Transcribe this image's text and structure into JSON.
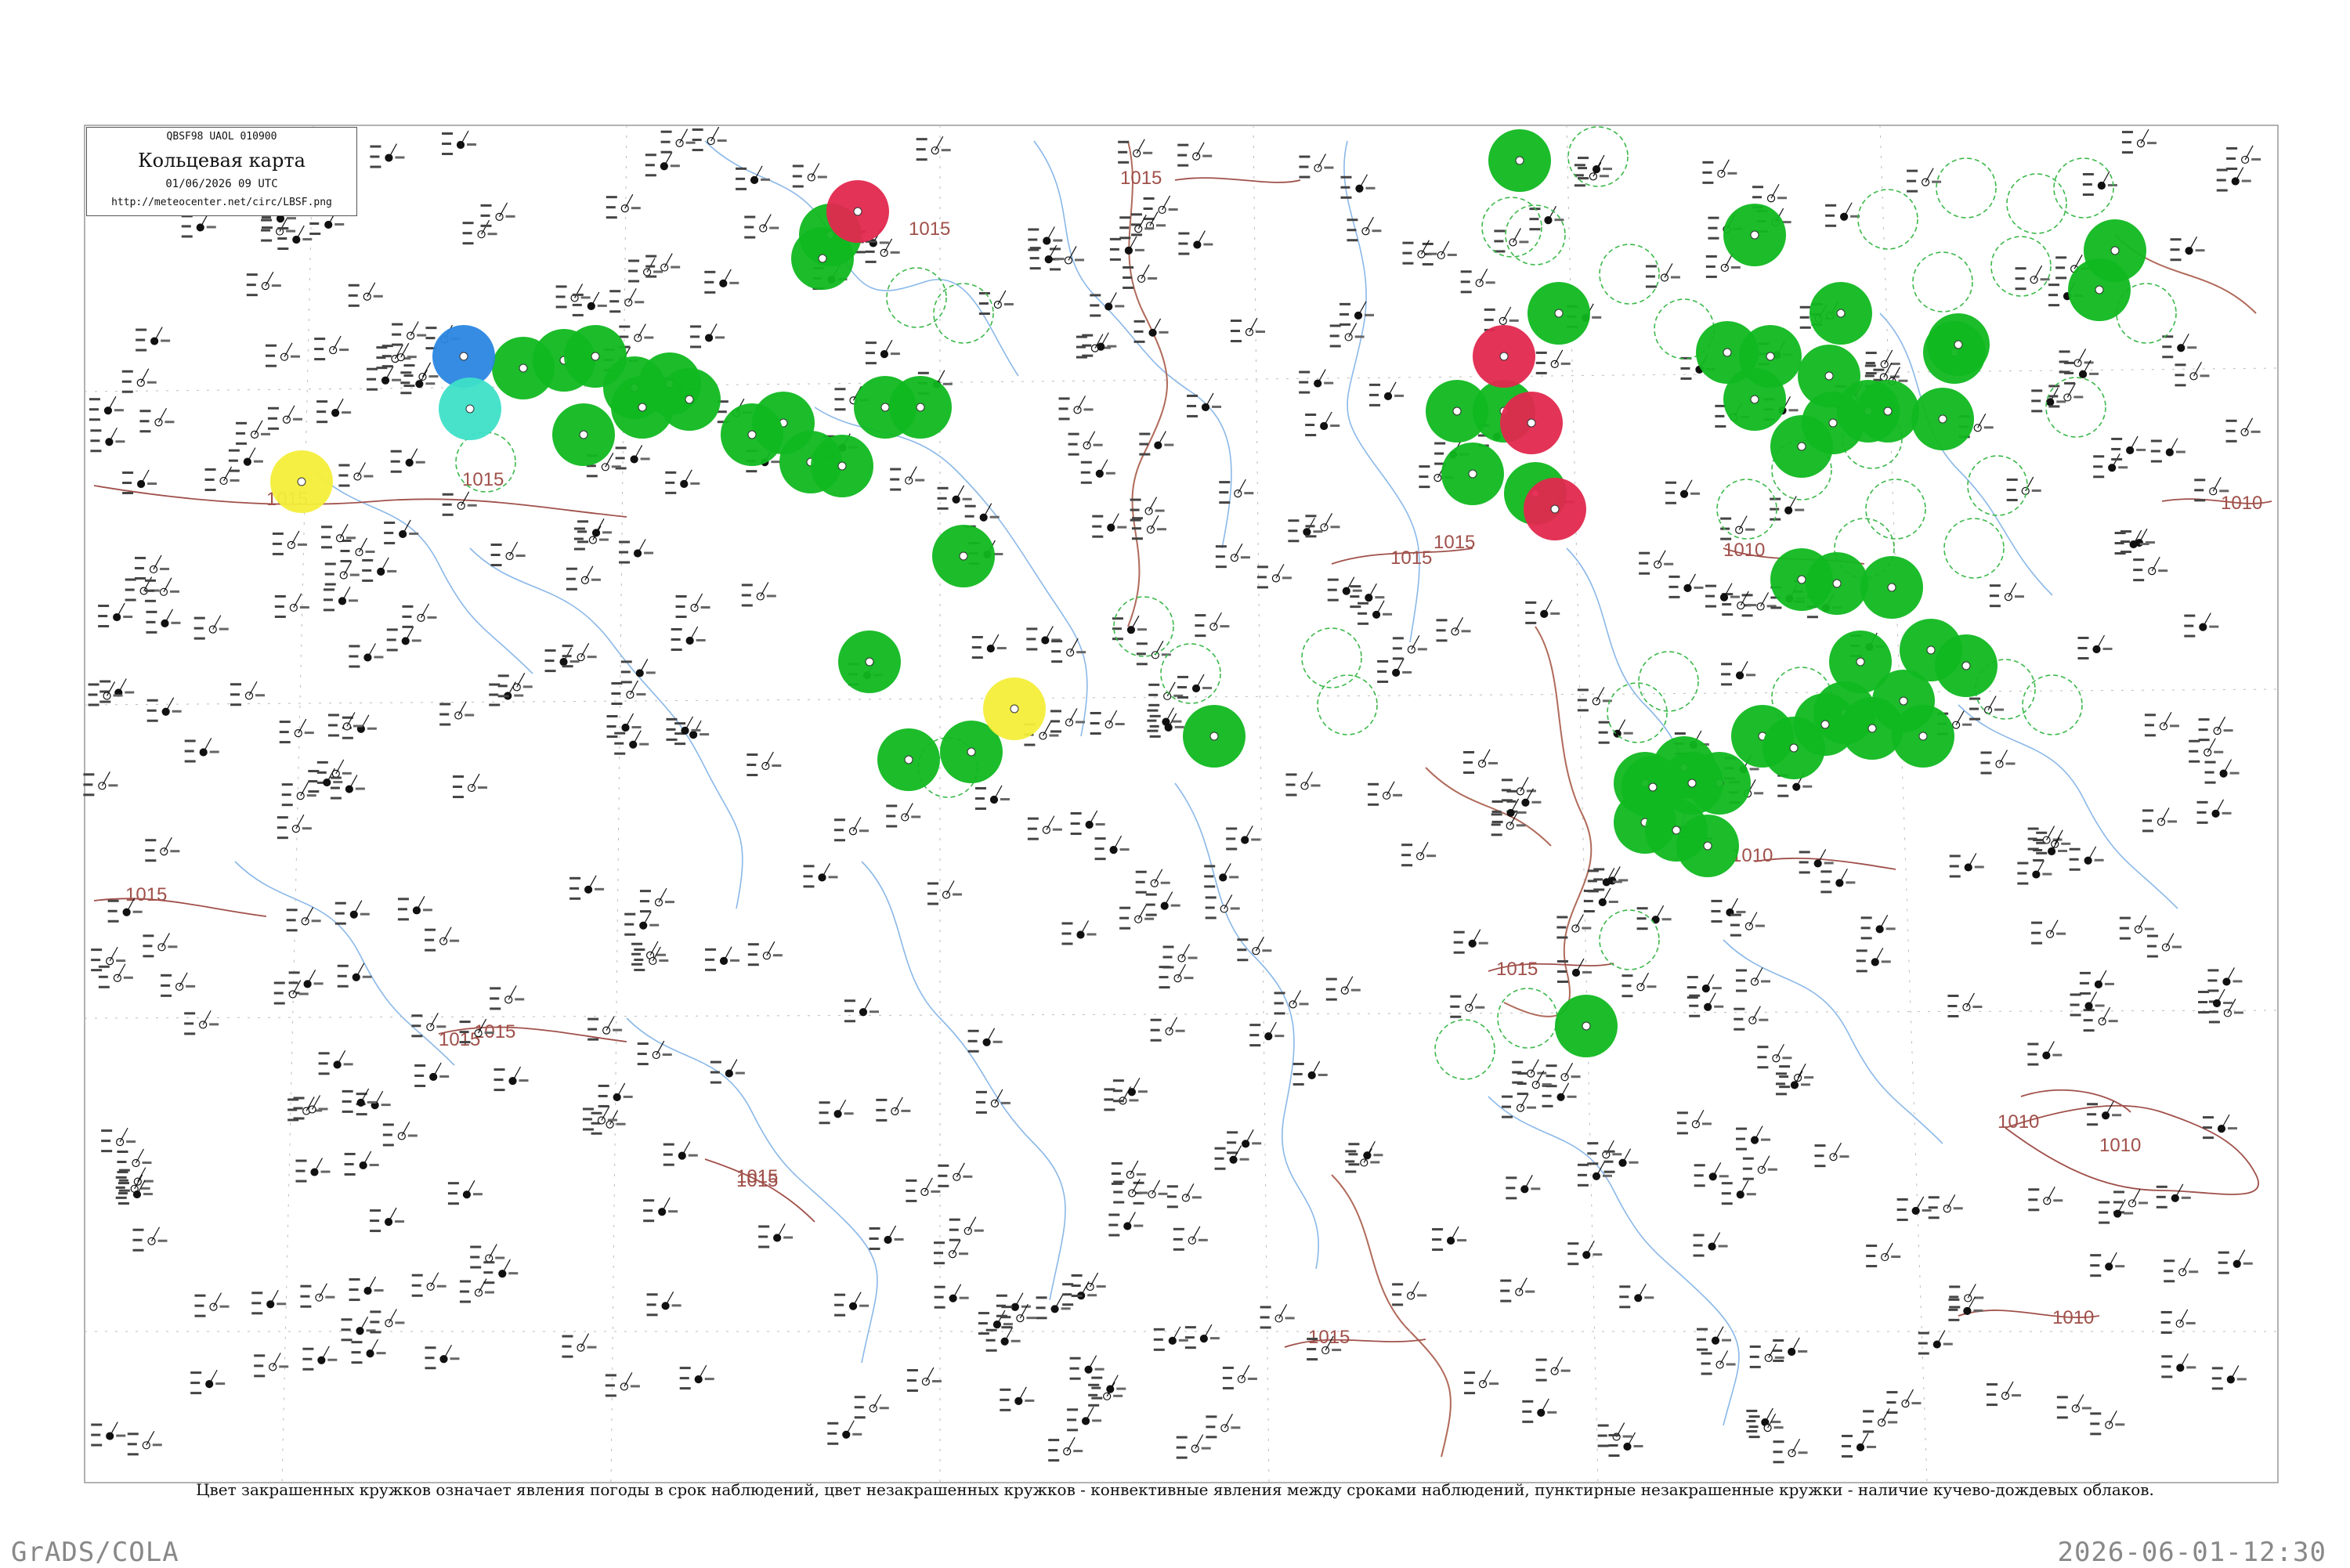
{
  "header": {
    "line1": "QBSF98  UAOL  010900",
    "title": "Кольцевая карта",
    "datetime": "01/06/2026 09 UTC",
    "url": "http://meteocenter.net/circ/LBSF.png"
  },
  "caption": "Цвет закрашенных кружков означает явления погоды в срок наблюдений, цвет незакрашенных кружков - конвективные явления между сроками наблюдений, пунктирные незакрашенные кружки - наличие кучево-дождевых облаков.",
  "footer": {
    "left": "GrADS/COLA",
    "right": "2026-06-01-12:30"
  },
  "colors": {
    "rain": "#10b820",
    "thunder": "#e2284e",
    "snow": "#2a86e0",
    "fog": "#f4ee3a",
    "haze": "#3ee0c8",
    "isobar": "#a0504a",
    "river": "#8ab8e8"
  },
  "isobar_labels": [
    "1015",
    "1015",
    "1015",
    "1015",
    "1015",
    "1015",
    "1015",
    "1015",
    "1015",
    "1015",
    "1015",
    "1010",
    "1010",
    "1010",
    "1010",
    "1010",
    "1010",
    "1015",
    "1015"
  ],
  "stations": {
    "filled": [
      {
        "color": "rain",
        "count": 64
      },
      {
        "color": "thunder",
        "count": 4
      },
      {
        "color": "snow",
        "count": 1
      },
      {
        "color": "fog",
        "count": 2
      },
      {
        "color": "haze",
        "count": 1
      }
    ]
  }
}
